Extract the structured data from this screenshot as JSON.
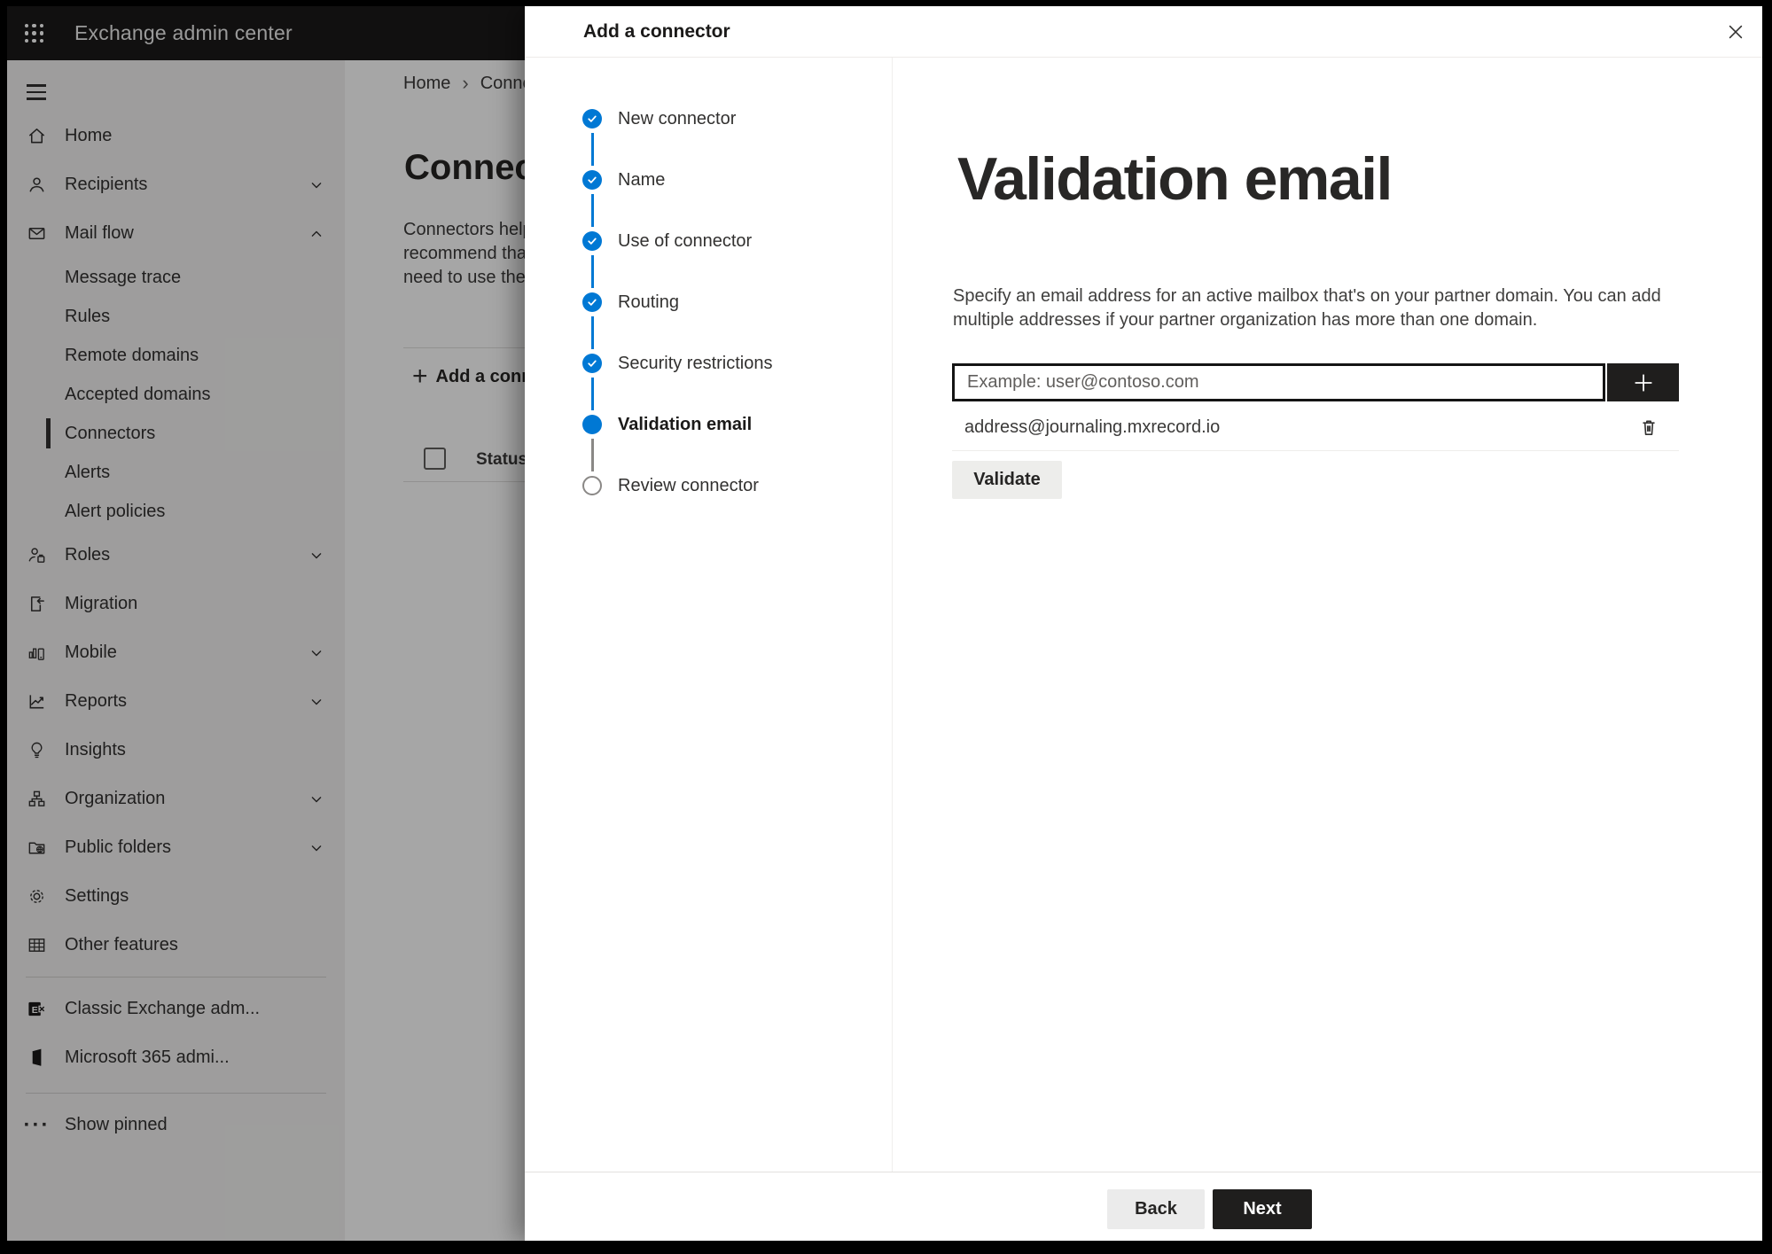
{
  "app": {
    "title": "Exchange admin center"
  },
  "colors": {
    "accent_blue": "#0078d4",
    "topbar_bg": "#1b1a19",
    "sidebar_bg": "#f3f2f1",
    "primary_button_bg": "#1f1e1d"
  },
  "breadcrumb": {
    "items": [
      "Home",
      "Connectors"
    ],
    "separator": "›"
  },
  "background_page": {
    "heading": "Connectors",
    "description_lines": [
      "Connectors help",
      "recommend that",
      "need to use them"
    ],
    "add_button_label": "Add a connector",
    "plus_glyph": "+",
    "table": {
      "status_header": "Status"
    }
  },
  "sidebar": {
    "items": [
      {
        "label": "Home",
        "icon": "home-icon",
        "level": "top",
        "chevron": "none",
        "selected": false
      },
      {
        "label": "Recipients",
        "icon": "person-icon",
        "level": "top",
        "chevron": "down",
        "selected": false
      },
      {
        "label": "Mail flow",
        "icon": "mail-icon",
        "level": "top",
        "chevron": "up",
        "selected": false
      },
      {
        "label": "Message trace",
        "icon": "",
        "level": "sub",
        "chevron": "none",
        "selected": false
      },
      {
        "label": "Rules",
        "icon": "",
        "level": "sub",
        "chevron": "none",
        "selected": false
      },
      {
        "label": "Remote domains",
        "icon": "",
        "level": "sub",
        "chevron": "none",
        "selected": false
      },
      {
        "label": "Accepted domains",
        "icon": "",
        "level": "sub",
        "chevron": "none",
        "selected": false
      },
      {
        "label": "Connectors",
        "icon": "",
        "level": "sub",
        "chevron": "none",
        "selected": true
      },
      {
        "label": "Alerts",
        "icon": "",
        "level": "sub",
        "chevron": "none",
        "selected": false
      },
      {
        "label": "Alert policies",
        "icon": "",
        "level": "sub",
        "chevron": "none",
        "selected": false
      },
      {
        "label": "Roles",
        "icon": "roles-icon",
        "level": "top",
        "chevron": "down",
        "selected": false
      },
      {
        "label": "Migration",
        "icon": "migration-icon",
        "level": "top",
        "chevron": "none",
        "selected": false
      },
      {
        "label": "Mobile",
        "icon": "mobile-icon",
        "level": "top",
        "chevron": "down",
        "selected": false
      },
      {
        "label": "Reports",
        "icon": "reports-icon",
        "level": "top",
        "chevron": "down",
        "selected": false
      },
      {
        "label": "Insights",
        "icon": "insights-icon",
        "level": "top",
        "chevron": "none",
        "selected": false
      },
      {
        "label": "Organization",
        "icon": "organization-icon",
        "level": "top",
        "chevron": "down",
        "selected": false
      },
      {
        "label": "Public folders",
        "icon": "public-folders-icon",
        "level": "top",
        "chevron": "down",
        "selected": false
      },
      {
        "label": "Settings",
        "icon": "settings-icon",
        "level": "top",
        "chevron": "none",
        "selected": false
      },
      {
        "label": "Other features",
        "icon": "other-features-icon",
        "level": "top",
        "chevron": "none",
        "selected": false
      },
      {
        "divider": true
      },
      {
        "label": "Classic Exchange adm...",
        "icon": "classic-exchange-icon",
        "level": "top",
        "chevron": "none",
        "selected": false
      },
      {
        "label": "Microsoft 365 admi...",
        "icon": "microsoft-365-icon",
        "level": "top",
        "chevron": "none",
        "selected": false
      },
      {
        "divider": true,
        "wide": true
      },
      {
        "label": "Show pinned",
        "icon": "ellipsis-icon",
        "level": "top",
        "chevron": "none",
        "selected": false
      }
    ]
  },
  "panel": {
    "title": "Add a connector",
    "steps": [
      {
        "label": "New connector",
        "state": "done"
      },
      {
        "label": "Name",
        "state": "done"
      },
      {
        "label": "Use of connector",
        "state": "done"
      },
      {
        "label": "Routing",
        "state": "done"
      },
      {
        "label": "Security restrictions",
        "state": "done"
      },
      {
        "label": "Validation email",
        "state": "current"
      },
      {
        "label": "Review connector",
        "state": "todo"
      }
    ],
    "content": {
      "title": "Validation email",
      "description_lines": [
        "Specify an email address for an active mailbox that's on your partner domain. You can add",
        "multiple addresses if your partner organization has more than one domain."
      ],
      "input_placeholder": "Example: user@contoso.com",
      "input_value": "",
      "addresses": [
        "address@journaling.mxrecord.io"
      ],
      "validate_label": "Validate"
    },
    "footer": {
      "back_label": "Back",
      "next_label": "Next"
    }
  }
}
